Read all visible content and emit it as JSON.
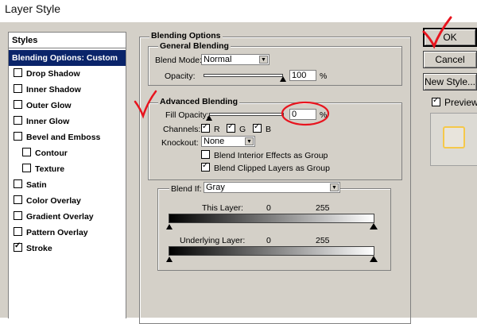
{
  "window": {
    "title": "Layer Style"
  },
  "sidebar": {
    "header": "Styles",
    "items": [
      {
        "label": "Blending Options: Custom",
        "selected": true,
        "checkbox": false,
        "indent": false
      },
      {
        "label": "Drop Shadow",
        "checked": false,
        "checkbox": true,
        "indent": false
      },
      {
        "label": "Inner Shadow",
        "checked": false,
        "checkbox": true,
        "indent": false
      },
      {
        "label": "Outer Glow",
        "checked": false,
        "checkbox": true,
        "indent": false
      },
      {
        "label": "Inner Glow",
        "checked": false,
        "checkbox": true,
        "indent": false
      },
      {
        "label": "Bevel and Emboss",
        "checked": false,
        "checkbox": true,
        "indent": false
      },
      {
        "label": "Contour",
        "checked": false,
        "checkbox": true,
        "indent": true
      },
      {
        "label": "Texture",
        "checked": false,
        "checkbox": true,
        "indent": true
      },
      {
        "label": "Satin",
        "checked": false,
        "checkbox": true,
        "indent": false
      },
      {
        "label": "Color Overlay",
        "checked": false,
        "checkbox": true,
        "indent": false
      },
      {
        "label": "Gradient Overlay",
        "checked": false,
        "checkbox": true,
        "indent": false
      },
      {
        "label": "Pattern Overlay",
        "checked": false,
        "checkbox": true,
        "indent": false
      },
      {
        "label": "Stroke",
        "checked": true,
        "checkbox": true,
        "indent": false
      }
    ]
  },
  "blending_options": {
    "title": "Blending Options",
    "general": {
      "title": "General Blending",
      "blend_mode_label": "Blend Mode:",
      "blend_mode_value": "Normal",
      "opacity_label": "Opacity:",
      "opacity_value": "100",
      "opacity_unit": "%",
      "opacity_level": 1.0
    },
    "advanced": {
      "title": "Advanced Blending",
      "fill_opacity_label": "Fill Opacity:",
      "fill_opacity_value": "0",
      "fill_opacity_unit": "%",
      "fill_opacity_level": 0.0,
      "channels_label": "Channels:",
      "channels": [
        {
          "label": "R",
          "checked": true
        },
        {
          "label": "G",
          "checked": true
        },
        {
          "label": "B",
          "checked": true
        }
      ],
      "knockout_label": "Knockout:",
      "knockout_value": "None",
      "blend_interior_label": "Blend Interior Effects as Group",
      "blend_interior_checked": false,
      "blend_clipped_label": "Blend Clipped Layers as Group",
      "blend_clipped_checked": true
    },
    "blend_if": {
      "label": "Blend If:",
      "value": "Gray",
      "this_layer_label": "This Layer:",
      "this_layer_min": "0",
      "this_layer_max": "255",
      "underlying_label": "Underlying Layer:",
      "underlying_min": "0",
      "underlying_max": "255"
    }
  },
  "buttons": {
    "ok": "OK",
    "cancel": "Cancel",
    "new_style": "New Style...",
    "preview_label": "Preview",
    "preview_checked": true
  },
  "colors": {
    "dialog_bg": "#d4d0c8",
    "selection": "#0a246a",
    "annotation": "#e8141e",
    "preview_swatch_border": "#f5c84a"
  }
}
